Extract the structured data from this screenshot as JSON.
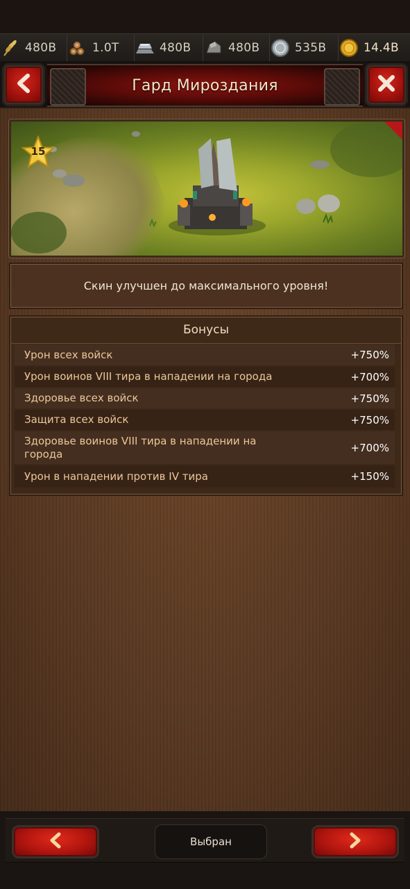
{
  "resources": [
    {
      "icon": "wheat-icon",
      "value": "480B"
    },
    {
      "icon": "wood-logs-icon",
      "value": "1.0T"
    },
    {
      "icon": "iron-ingot-icon",
      "value": "480B"
    },
    {
      "icon": "stone-icon",
      "value": "480B"
    },
    {
      "icon": "silver-coin-icon",
      "value": "535B"
    },
    {
      "icon": "gold-coin-icon",
      "value": "14.4B"
    }
  ],
  "header": {
    "title": "Гард Мироздания",
    "back_icon": "chevron-left-icon",
    "close_icon": "close-x-icon"
  },
  "banner": {
    "level": "15"
  },
  "notice": "Скин улучшен до максимального уровня!",
  "bonuses": {
    "title": "Бонусы",
    "rows": [
      {
        "label": "Урон всех войск",
        "value": "+750%"
      },
      {
        "label": "Урон воинов VIII тира в нападении на города",
        "value": "+700%"
      },
      {
        "label": "Здоровье всех войск",
        "value": "+750%"
      },
      {
        "label": "Защита всех войск",
        "value": "+750%"
      },
      {
        "label": "Здоровье воинов VIII тира в нападении на города",
        "value": "+700%"
      },
      {
        "label": "Урон в нападении против IV тира",
        "value": "+150%"
      }
    ]
  },
  "footer": {
    "selected_label": "Выбран"
  },
  "colors": {
    "accent_red": "#c0140e",
    "panel_brown": "#563620",
    "bonus_text": "#ecc79a"
  }
}
